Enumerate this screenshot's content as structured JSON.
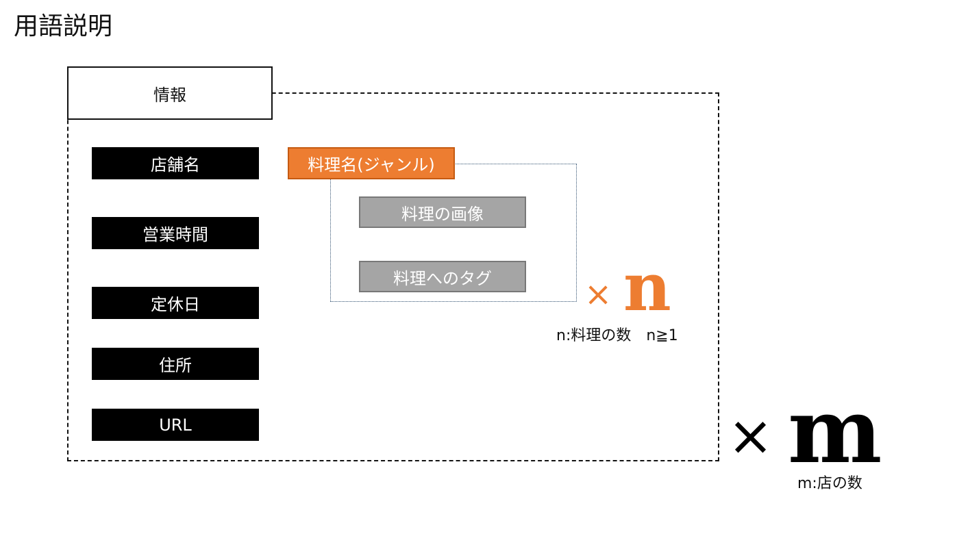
{
  "title": "用語説明",
  "info_label": "情報",
  "store_fields": [
    "店舗名",
    "営業時間",
    "定休日",
    "住所",
    "URL"
  ],
  "dish": {
    "label": "料理名(ジャンル)",
    "children": [
      "料理の画像",
      "料理へのタグ"
    ]
  },
  "multiplier_n": {
    "times": "×",
    "var": "n",
    "note": "n:料理の数　n≧1"
  },
  "multiplier_m": {
    "times": "×",
    "var": "m",
    "note": "m:店の数"
  },
  "colors": {
    "orange": "#ed7d31",
    "gray": "#a5a5a5",
    "black": "#000000"
  }
}
